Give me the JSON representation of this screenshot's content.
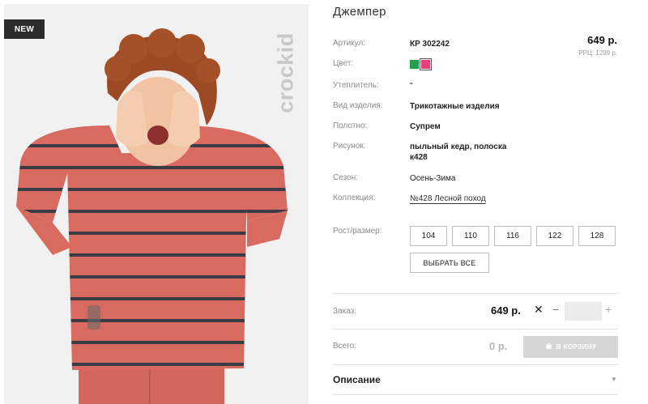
{
  "badge": "NEW",
  "brand": "crockid",
  "product": {
    "title": "Джемпер",
    "price": "649 р.",
    "rrp": "РРЦ: 1299 р."
  },
  "details": {
    "article_label": "Артикул:",
    "article_value": "КР 302242",
    "color_label": "Цвет:",
    "colors": [
      "#23a04f",
      "#e6407a"
    ],
    "insulation_label": "Утеплитель:",
    "insulation_value": "\"",
    "kind_label": "Вид изделия:",
    "kind_value": "Трикотажные изделия",
    "fabric_label": "Полотно:",
    "fabric_value": "Супрем",
    "pattern_label": "Рисунок:",
    "pattern_value": "пыльный кедр, полоска к428",
    "season_label": "Сезон:",
    "season_value": "Осень-Зима",
    "collection_label": "Коллекция:",
    "collection_value": "№428 Лесной поход"
  },
  "sizes": {
    "label": "Рост/размер:",
    "options": [
      "104",
      "110",
      "116",
      "122",
      "128"
    ],
    "select_all": "ВЫБРАТЬ ВСЕ"
  },
  "order": {
    "label": "Заказ:",
    "price": "649 р.",
    "clear_icon": "✕",
    "minus": "−",
    "plus": "+"
  },
  "total": {
    "label": "Всего:",
    "value": "0 р.",
    "cart_button": "В КОРЗИНУ"
  },
  "description": {
    "label": "Описание",
    "arrow": "▼"
  }
}
